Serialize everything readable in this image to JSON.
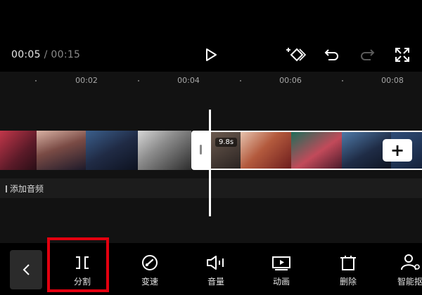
{
  "player": {
    "current_time": "00:05",
    "separator": "/",
    "total_time": "00:15",
    "icons": [
      "play-icon",
      "keyframe-add-icon",
      "undo-icon",
      "redo-icon",
      "fullscreen-icon"
    ]
  },
  "ruler": {
    "labels": [
      "00:02",
      "00:04",
      "00:06",
      "00:08"
    ]
  },
  "timeline": {
    "clip_duration": "9.8s",
    "add_button": "+"
  },
  "audio": {
    "label": "添加音频"
  },
  "toolbar": {
    "tools": [
      {
        "label": "分割",
        "icon": "split-icon"
      },
      {
        "label": "变速",
        "icon": "speed-icon"
      },
      {
        "label": "音量",
        "icon": "volume-icon"
      },
      {
        "label": "动画",
        "icon": "animation-icon"
      },
      {
        "label": "删除",
        "icon": "delete-icon"
      },
      {
        "label": "智能抠",
        "icon": "smart-cutout-icon"
      }
    ]
  },
  "colors": {
    "highlight": "#e3000f",
    "background": "#000000",
    "timeline_bg": "#121212"
  }
}
